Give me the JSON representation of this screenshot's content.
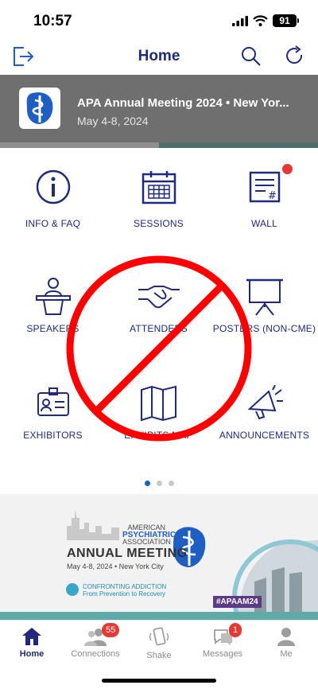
{
  "status_bar": {
    "time": "10:57",
    "battery": "91"
  },
  "nav": {
    "title": "Home"
  },
  "event": {
    "title": "APA Annual Meeting 2024 • New Yor...",
    "dates": "May 4-8, 2024"
  },
  "tiles": [
    {
      "label": "INFO & FAQ",
      "icon": "info-icon"
    },
    {
      "label": "SESSIONS",
      "icon": "calendar-icon"
    },
    {
      "label": "WALL",
      "icon": "wall-icon"
    },
    {
      "label": "SPEAKERS",
      "icon": "podium-icon"
    },
    {
      "label": "ATTENDEES",
      "icon": "handshake-icon"
    },
    {
      "label": "POSTERS (NON-CME)",
      "icon": "poster-icon"
    },
    {
      "label": "EXHIBITORS",
      "icon": "badge-icon"
    },
    {
      "label": "EXHIBITS MAP",
      "icon": "map-icon"
    },
    {
      "label": "ANNOUNCEMENTS",
      "icon": "megaphone-icon"
    }
  ],
  "pager": {
    "pages": 3,
    "active": 0
  },
  "promo": {
    "org_line1": "AMERICAN",
    "org_line2": "PSYCHIATRIC",
    "org_line3": "ASSOCIATION",
    "headline": "ANNUAL MEETING",
    "dates": "May 4-8, 2024 • New York City",
    "tagline1": "CONFRONTING ADDICTION",
    "tagline2": "From Prevention to Recovery",
    "hashtag": "#APAAM24"
  },
  "tabs": [
    {
      "label": "Home",
      "badge": ""
    },
    {
      "label": "Connections",
      "badge": "55"
    },
    {
      "label": "Shake",
      "badge": ""
    },
    {
      "label": "Messages",
      "badge": "1"
    },
    {
      "label": "Me",
      "badge": ""
    }
  ],
  "colors": {
    "brand": "#1f2a7a",
    "accent_red": "#e53935",
    "prohibit_red": "#ff0000"
  }
}
